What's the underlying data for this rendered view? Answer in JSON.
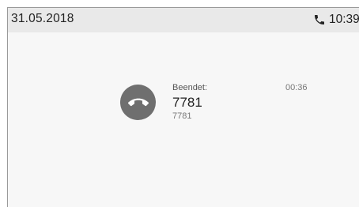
{
  "status_bar": {
    "date": "31.05.2018",
    "time": "10:39",
    "icon": "phone-icon"
  },
  "call": {
    "icon": "end-call-icon",
    "status": "Beendet:",
    "duration": "00:36",
    "name": "7781",
    "number": "7781"
  }
}
